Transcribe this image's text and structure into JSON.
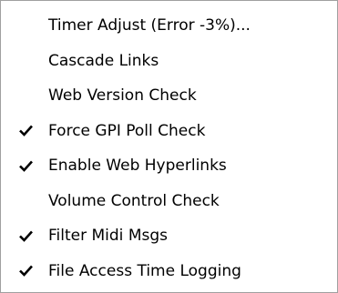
{
  "menu": {
    "items": [
      {
        "label": "Timer Adjust (Error -3%)...",
        "checked": false
      },
      {
        "label": "Cascade Links",
        "checked": false
      },
      {
        "label": "Web Version Check",
        "checked": false
      },
      {
        "label": "Force GPI Poll Check",
        "checked": true,
        "check_icon": "checkmark-icon"
      },
      {
        "label": "Enable Web Hyperlinks",
        "checked": true,
        "check_icon": "checkmark-icon"
      },
      {
        "label": "Volume Control Check",
        "checked": false
      },
      {
        "label": "Filter Midi Msgs",
        "checked": true,
        "check_icon": "checkmark-icon"
      },
      {
        "label": "File Access Time Logging",
        "checked": true,
        "check_icon": "checkmark-icon"
      }
    ]
  },
  "colors": {
    "background": "#ffffff",
    "text": "#000000",
    "border": "#a0a0a0"
  }
}
